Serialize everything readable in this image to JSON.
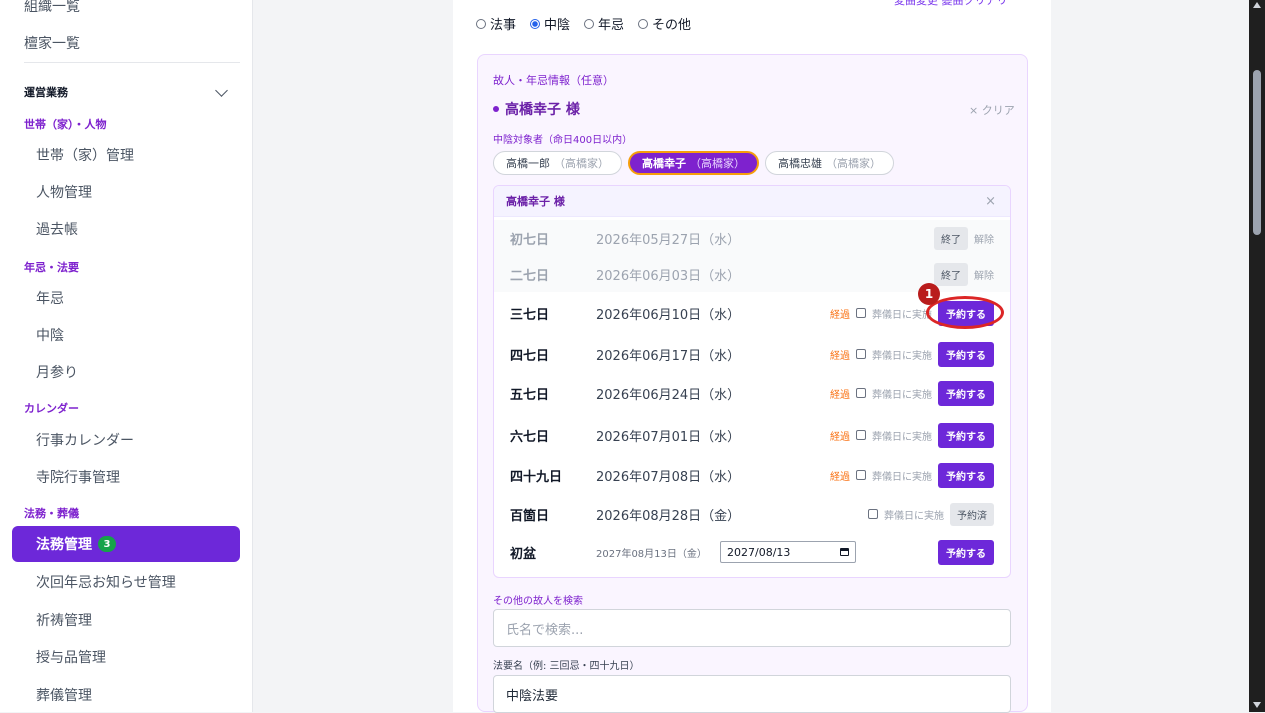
{
  "sidebar": {
    "top_items": [
      "組織一覧",
      "檀家一覧"
    ],
    "section": "運営業務",
    "groups": {
      "household": "世帯（家）・人物",
      "memorial": "年忌・法要",
      "calendar": "カレンダー",
      "funeral": "法務・葬儀"
    },
    "items": {
      "household_mgmt": "世帯（家）管理",
      "person_mgmt": "人物管理",
      "kakocho": "過去帳",
      "nenki": "年忌",
      "chuin": "中陰",
      "tsukimairi": "月参り",
      "event_calendar": "行事カレンダー",
      "temple_events": "寺院行事管理",
      "homu_mgmt": "法務管理",
      "homu_badge": "3",
      "next_notice": "次回年忌お知らせ管理",
      "kito": "祈祷管理",
      "juyohin": "授与品管理",
      "sogi": "葬儀管理"
    }
  },
  "form": {
    "top_link": "変曲変更 變曲クリアリ",
    "types": [
      {
        "label": "法事",
        "checked": false
      },
      {
        "label": "中陰",
        "checked": true
      },
      {
        "label": "年忌",
        "checked": false
      },
      {
        "label": "その他",
        "checked": false
      }
    ],
    "deceased_label": "故人・年忌情報（任意）",
    "selected_person": "高橋幸子 様",
    "clear_label": "× クリア",
    "chuin_target_label": "中陰対象者（命日400日以内）",
    "chips": [
      {
        "name": "高橋一郎",
        "family": "（高橋家）",
        "selected": false
      },
      {
        "name": "高橋幸子",
        "family": "（高橋家）",
        "selected": true
      },
      {
        "name": "高橋忠雄",
        "family": "（高橋家）",
        "selected": false
      }
    ],
    "schedule": {
      "title": "高橋幸子 様",
      "close": "×",
      "done_label": "終了",
      "undo_label": "解除",
      "passed_label": "経過",
      "funeral_label": "葬儀日に実施",
      "reserve_label": "予約する",
      "reserved_label": "予約済",
      "rows": [
        {
          "name": "初七日",
          "date": "2026年05月27日（水）"
        },
        {
          "name": "二七日",
          "date": "2026年06月03日（水）"
        },
        {
          "name": "三七日",
          "date": "2026年06月10日（水）"
        },
        {
          "name": "四七日",
          "date": "2026年06月17日（水）"
        },
        {
          "name": "五七日",
          "date": "2026年06月24日（水）"
        },
        {
          "name": "六七日",
          "date": "2026年07月01日（水）"
        },
        {
          "name": "四十九日",
          "date": "2026年07月08日（水）"
        },
        {
          "name": "百箇日",
          "date": "2026年08月28日（金）"
        },
        {
          "name": "初盆",
          "date": "2027年08月13日（金）",
          "input_value": "2027/08/13"
        }
      ]
    },
    "search_label": "その他の故人を検索",
    "search_placeholder": "氏名で検索...",
    "hoyo_name_label": "法要名（例: 三回忌・四十九日）",
    "hoyo_name_value": "中陰法要"
  },
  "annotation": {
    "number": "1"
  },
  "colors": {
    "accent": "#6d28d9",
    "annotation": "#dc2626",
    "passed": "#f97316"
  }
}
